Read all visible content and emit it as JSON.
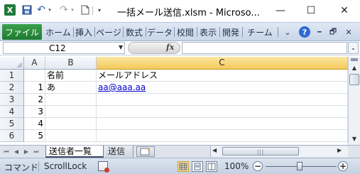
{
  "window": {
    "title": "一括メール送信.xlsm  -  Microso...",
    "app_icon_letter": "X",
    "controls": {
      "minimize": "—",
      "maximize": "☐",
      "close": "✕"
    }
  },
  "qat": {
    "undo": "↶",
    "redo": "↷",
    "dropdown": "▾",
    "customize": "▾"
  },
  "ribbon": {
    "file_tab": "ファイル",
    "tabs": [
      "ホーム",
      "挿入",
      "ページ",
      "数式",
      "データ",
      "校閲",
      "表示",
      "開発",
      "チーム"
    ],
    "chevron": "⌄",
    "help": "?",
    "window_min": "━",
    "window_restore": "🗗",
    "window_close": "✕"
  },
  "formula_bar": {
    "name_box": "C12",
    "name_dropdown": "▼",
    "fx": "fx",
    "formula": "",
    "expand": "⌄"
  },
  "grid": {
    "columns": [
      "A",
      "B",
      "C"
    ],
    "active_column": "C",
    "rows": [
      "1",
      "2",
      "3",
      "4",
      "5",
      "6"
    ],
    "cells": {
      "B1": "名前",
      "C1": "メールアドレス",
      "A2": "1",
      "B2": "あ",
      "C2": "aa@aaa.aa",
      "A3": "2",
      "A4": "3",
      "A5": "4",
      "A6": "5"
    },
    "link_color": "#0000cc",
    "header_highlight": "#f6c95a"
  },
  "scrollbar": {
    "up": "▲",
    "down": "▼"
  },
  "sheets": {
    "nav": [
      "⏮",
      "◀",
      "▶",
      "⏭"
    ],
    "active": "送信者一覧",
    "others": [
      "送信"
    ],
    "hscroll_left": "◀",
    "hscroll_right": "▶",
    "hscroll_grip": "|||"
  },
  "statusbar": {
    "mode": "コマンド",
    "scroll_lock": "ScrollLock",
    "zoom": "100%",
    "zoom_minus": "−",
    "zoom_plus": "+"
  },
  "colors": {
    "file_tab": "#1f7a32",
    "ribbon_bg": "#cfdbeb",
    "statusbar_bg": "#c5d1e1"
  }
}
